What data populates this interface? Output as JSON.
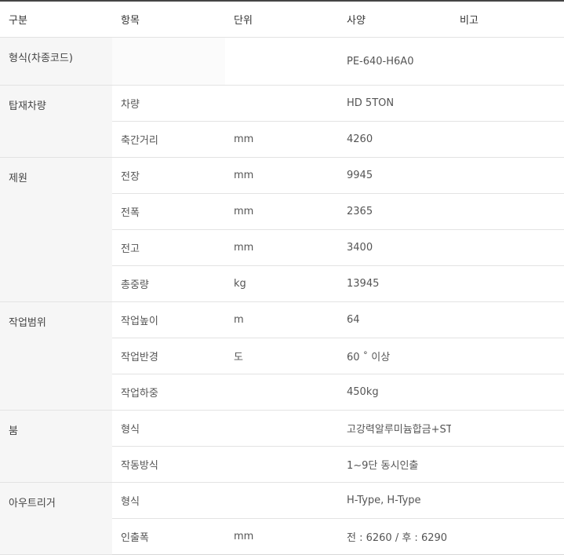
{
  "header": {
    "col_group": "구분",
    "col_item": "항목",
    "col_unit": "단위",
    "col_spec": "사양",
    "col_note": "비고"
  },
  "rows": {
    "model": {
      "group": "형식(차종코드)",
      "item": "",
      "unit": "",
      "spec": "PE-640-H6A0",
      "note": ""
    },
    "vehicle": {
      "group": "탑재차량",
      "r0": {
        "item": "차량",
        "unit": "",
        "spec": "HD 5TON",
        "note": ""
      },
      "r1": {
        "item": "축간거리",
        "unit": "mm",
        "spec": "4260",
        "note": ""
      }
    },
    "dimensions": {
      "group": "제원",
      "r0": {
        "item": "전장",
        "unit": "mm",
        "spec": "9945",
        "note": ""
      },
      "r1": {
        "item": "전폭",
        "unit": "mm",
        "spec": "2365",
        "note": ""
      },
      "r2": {
        "item": "전고",
        "unit": "mm",
        "spec": "3400",
        "note": ""
      },
      "r3": {
        "item": "총중량",
        "unit": "kg",
        "spec": "13945",
        "note": ""
      }
    },
    "work_range": {
      "group": "작업범위",
      "r0": {
        "item": "작업높이",
        "unit": "m",
        "spec": "64",
        "note": ""
      },
      "r1": {
        "item": "작업반경",
        "unit": "도",
        "spec": "60 ˚ 이상",
        "note": ""
      },
      "r2": {
        "item": "작업하중",
        "unit": "",
        "spec": "450kg",
        "note": ""
      }
    },
    "boom": {
      "group": "붐",
      "r0": {
        "item": "형식",
        "unit": "",
        "spec": "고강력알루미늄합금+STEEL",
        "note": ""
      },
      "r1": {
        "item": "작동방식",
        "unit": "",
        "spec": "1~9단 동시인출",
        "note": ""
      }
    },
    "outrigger": {
      "group": "아우트리거",
      "r0": {
        "item": "형식",
        "unit": "",
        "spec": "H-Type, H-Type",
        "note": ""
      },
      "r1": {
        "item": "인출폭",
        "unit": "mm",
        "spec": "전 : 6260 / 후 : 6290",
        "note": ""
      }
    }
  }
}
